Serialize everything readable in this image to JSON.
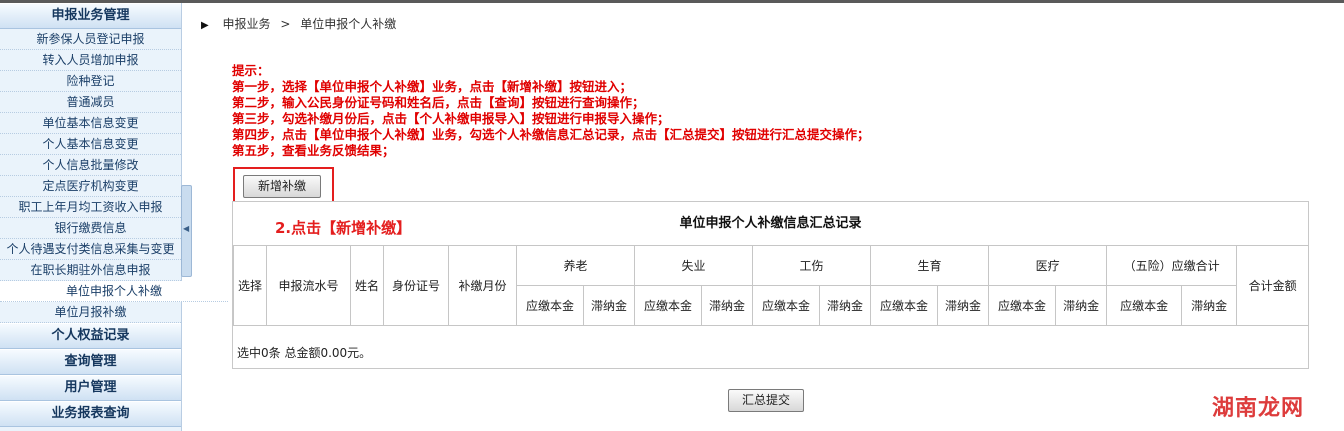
{
  "sidebar": {
    "sections": {
      "declare": "申报业务管理",
      "rights": "个人权益记录",
      "query": "查询管理",
      "users": "用户管理",
      "reports": "业务报表查询"
    },
    "items": [
      "新参保人员登记申报",
      "转入人员增加申报",
      "险种登记",
      "普通减员",
      "单位基本信息变更",
      "个人基本信息变更",
      "个人信息批量修改",
      "定点医疗机构变更",
      "职工上年月均工资收入申报",
      "银行缴费信息",
      "个人待遇支付类信息采集与变更",
      "在职长期驻外信息申报",
      "单位申报个人补缴",
      "单位月报补缴"
    ]
  },
  "breadcrumb": {
    "root": "申报业务",
    "separator": ">",
    "current": "单位申报个人补缴"
  },
  "tips": [
    "提示：",
    "第一步，选择【单位申报个人补缴】业务，点击【新增补缴】按钮进入；",
    "第二步，输入公民身份证号码和姓名后，点击【查询】按钮进行查询操作；",
    "第三步，勾选补缴月份后，点击【个人补缴申报导入】按钮进行申报导入操作；",
    "第四步，点击【单位申报个人补缴】业务，勾选个人补缴信息汇总记录，点击【汇总提交】按钮进行汇总提交操作；",
    "第五步，查看业务反馈结果；"
  ],
  "buttons": {
    "add": "新增补缴",
    "submit": "汇总提交"
  },
  "panel": {
    "title": "单位申报个人补缴信息汇总记录",
    "note": "2.点击【新增补缴】",
    "columns": {
      "select": "选择",
      "serial": "申报流水号",
      "name": "姓名",
      "id": "身份证号",
      "month": "补缴月份",
      "total": "合计金额"
    },
    "groups": [
      "养老",
      "失业",
      "工伤",
      "生育",
      "医疗",
      "（五险）应缴合计"
    ],
    "subcols": {
      "due": "应缴本金",
      "late": "滞纳金"
    },
    "summary": "选中0条 总金额0.00元。"
  },
  "watermark": "湖南龙网"
}
